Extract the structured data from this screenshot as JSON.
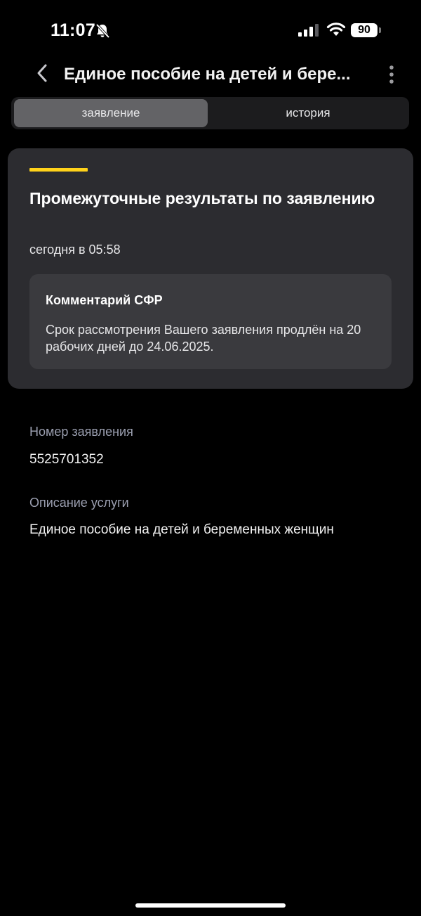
{
  "status_bar": {
    "time": "11:07",
    "battery": "90",
    "icons": [
      "bell-slash-icon",
      "signal-icon",
      "wifi-icon",
      "battery-icon"
    ]
  },
  "header": {
    "title": "Единое пособие на детей и бере...",
    "back_icon": "chevron-left-icon",
    "more_icon": "more-vertical-icon"
  },
  "tabs": [
    {
      "label": "заявление",
      "active": true
    },
    {
      "label": "история",
      "active": false
    }
  ],
  "card": {
    "accent_color": "#ffd21a",
    "title": "Промежуточные результаты по заявлению",
    "date": "сегодня в 05:58",
    "comment": {
      "title": "Комментарий СФР",
      "text": "Срок рассмотрения Вашего заявления продлён на 20 рабочих дней до 24.06.2025."
    }
  },
  "details": {
    "number_label": "Номер заявления",
    "number_value": "5525701352",
    "service_label": "Описание услуги",
    "service_value": "Единое пособие на детей и беременных женщин"
  }
}
